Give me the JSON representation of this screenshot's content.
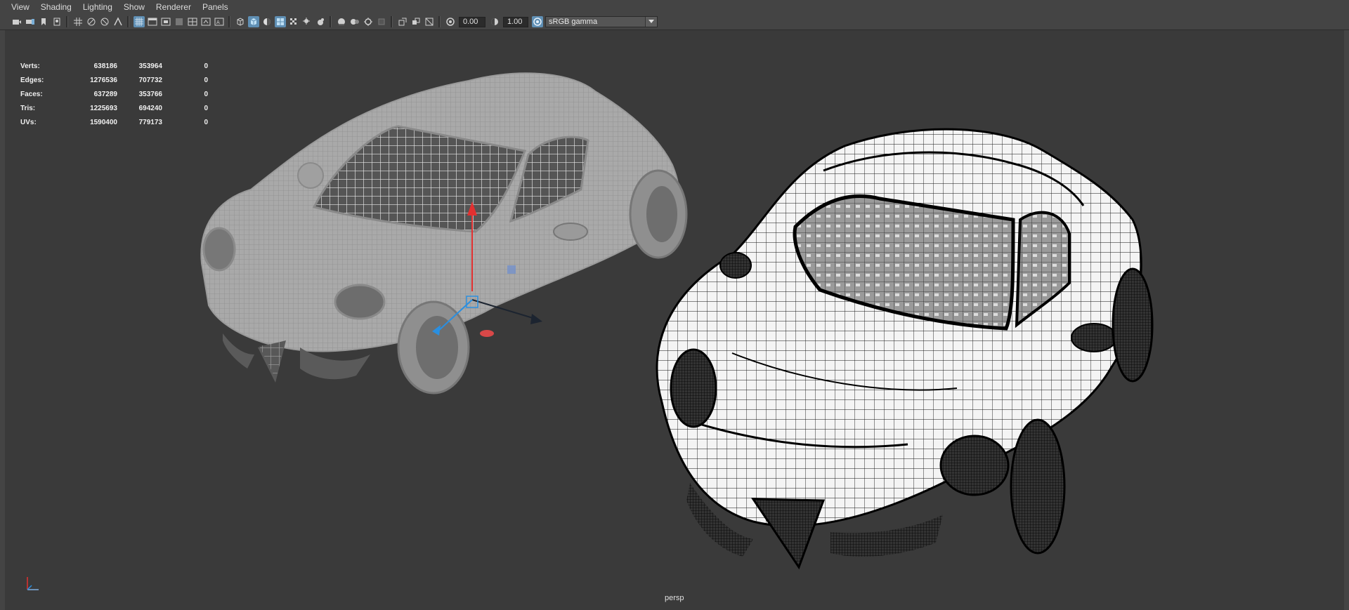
{
  "menu": {
    "items": [
      "View",
      "Shading",
      "Lighting",
      "Show",
      "Renderer",
      "Panels"
    ]
  },
  "toolbar": {
    "icons": [
      "camera-select-icon",
      "camera-attributes-icon",
      "bookmark-icon",
      "image-plane-icon",
      "grid-icon",
      "film-gate-icon",
      "resolution-gate-icon",
      "gate-mask-icon",
      "field-chart-icon",
      "safe-action-icon",
      "safe-title-icon",
      "wireframe-icon",
      "smooth-shade-icon",
      "wireframe-on-shaded-icon",
      "textured-icon",
      "use-lights-icon",
      "shadows-icon",
      "screen-space-ao-icon",
      "motion-blur-icon",
      "anti-aliasing-icon",
      "depth-of-field-icon",
      "isolate-select-icon",
      "xray-icon",
      "xray-active-icon",
      "xray-joints-icon",
      "exposure-icon",
      "gamma-icon",
      "color-management-icon"
    ],
    "exposure_value": "0.00",
    "gamma_value": "1.00",
    "color_space": "sRGB gamma"
  },
  "hud": {
    "rows": [
      {
        "label": "Verts:",
        "v1": "638186",
        "v2": "353964",
        "v3": "0"
      },
      {
        "label": "Edges:",
        "v1": "1276536",
        "v2": "707732",
        "v3": "0"
      },
      {
        "label": "Faces:",
        "v1": "637289",
        "v2": "353766",
        "v3": "0"
      },
      {
        "label": "Tris:",
        "v1": "1225693",
        "v2": "694240",
        "v3": "0"
      },
      {
        "label": "UVs:",
        "v1": "1590400",
        "v2": "779173",
        "v3": "0"
      }
    ]
  },
  "viewport": {
    "camera_label": "persp"
  },
  "colors": {
    "panel": "#444444",
    "viewport_bg": "#3a3a3a",
    "active_icon": "#5f8fb4",
    "gizmo_y": "#e23030",
    "gizmo_z": "#2a8fe0"
  }
}
